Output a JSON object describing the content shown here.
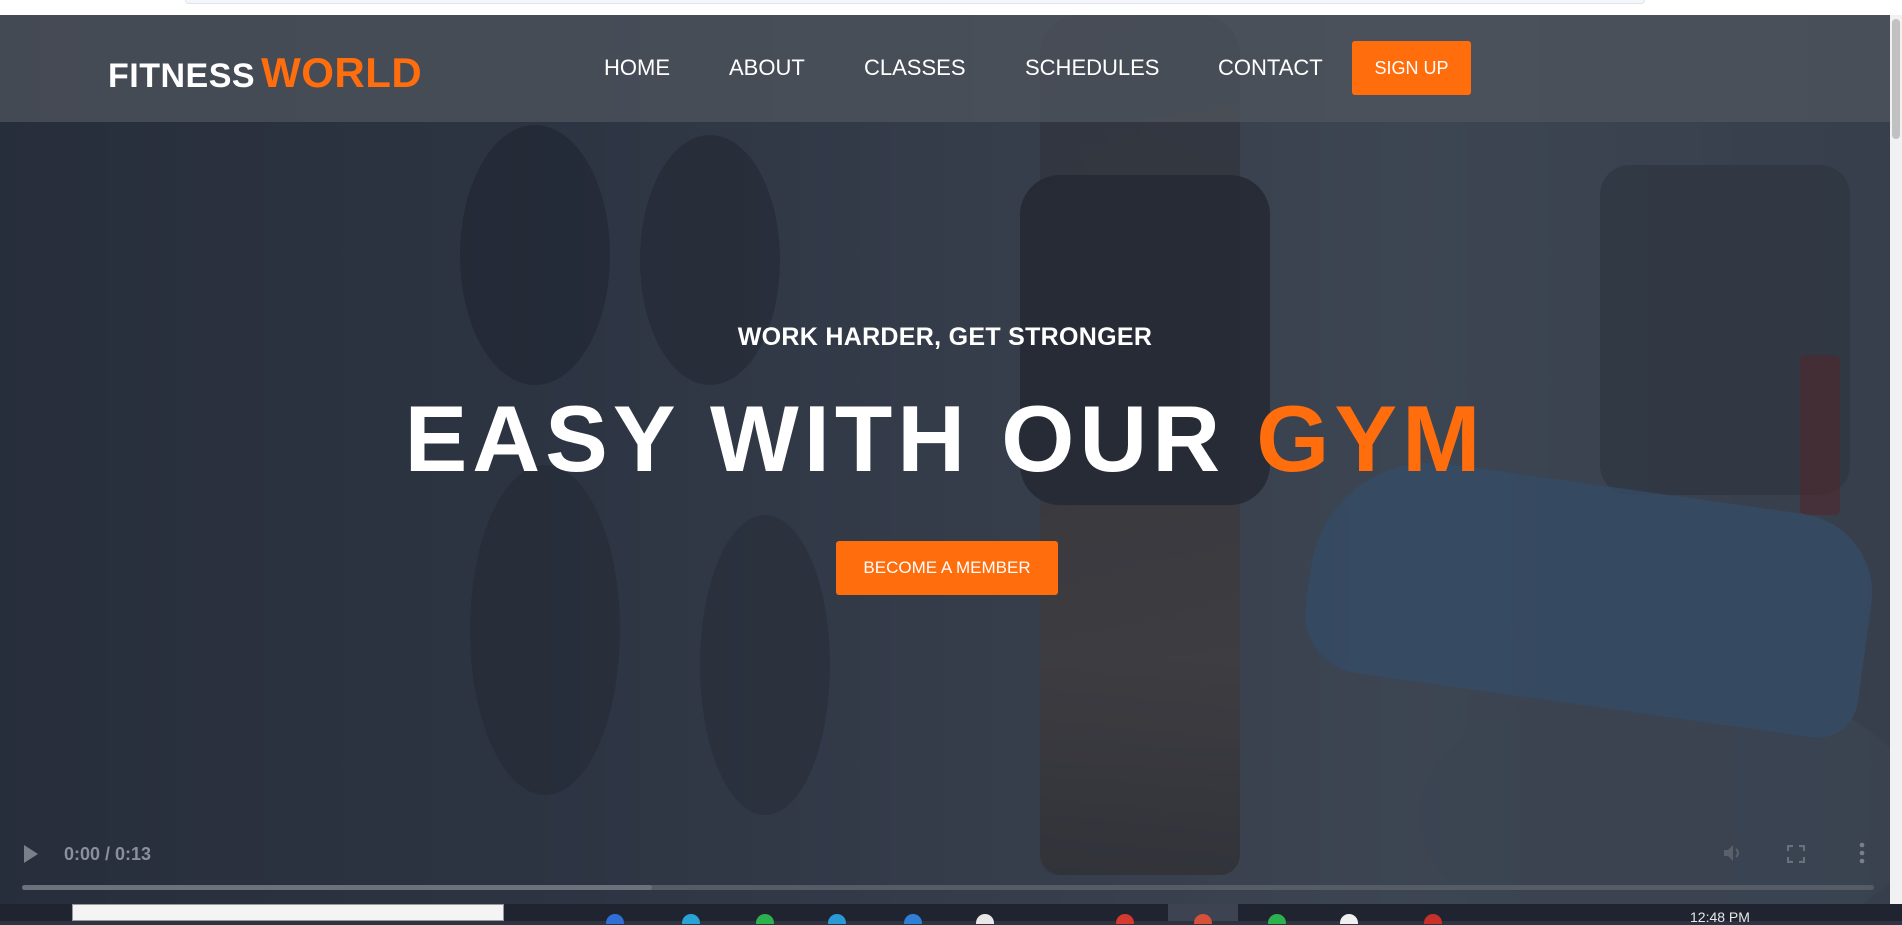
{
  "brand": {
    "name_part1": "FITNESS",
    "name_part2": "WORLD",
    "accent_color": "#ff6d0d"
  },
  "nav": {
    "links": [
      {
        "label": "HOME"
      },
      {
        "label": "ABOUT"
      },
      {
        "label": "CLASSES"
      },
      {
        "label": "SCHEDULES"
      },
      {
        "label": "CONTACT"
      }
    ],
    "signup_label": "SIGN UP"
  },
  "hero": {
    "tagline": "WORK HARDER, GET STRONGER",
    "headline_part1": "EASY WITH OUR",
    "headline_part2": "GYM",
    "cta_label": "BECOME A MEMBER"
  },
  "video": {
    "time_display": "0:00 / 0:13",
    "progress_fraction": 0.34,
    "icons": [
      "play-icon",
      "mute-icon",
      "fullscreen-icon",
      "more-options-icon"
    ]
  },
  "taskbar": {
    "clock": "12:48 PM",
    "icons": [
      "app-icon",
      "browser-icon",
      "chat-icon",
      "store-icon",
      "edge-icon",
      "file-icon",
      "red-app-icon",
      "chrome-icon",
      "green-app-icon",
      "white-app-icon",
      "red-app-icon"
    ]
  }
}
